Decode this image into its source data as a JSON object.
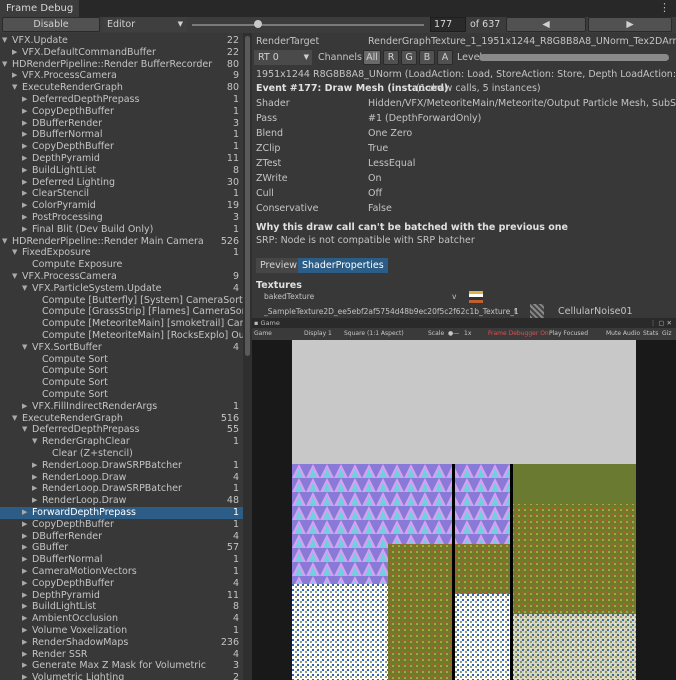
{
  "window": {
    "title": "Frame Debug",
    "menu_icon": "kebab-menu-icon"
  },
  "toolbar": {
    "disable_label": "Disable",
    "editor_label": "Editor",
    "event_index": "177",
    "event_total": "of 637",
    "slider_value": 0.28
  },
  "tree": [
    {
      "label": "VFX.Update",
      "count": "22",
      "depth": 0,
      "arrow": "down"
    },
    {
      "label": "VFX.DefaultCommandBuffer",
      "count": "22",
      "depth": 1,
      "arrow": "right"
    },
    {
      "label": "HDRenderPipeline::Render BufferRecorder",
      "count": "80",
      "depth": 0,
      "arrow": "down"
    },
    {
      "label": "VFX.ProcessCamera",
      "count": "9",
      "depth": 1,
      "arrow": "right"
    },
    {
      "label": "ExecuteRenderGraph",
      "count": "80",
      "depth": 1,
      "arrow": "down"
    },
    {
      "label": "DeferredDepthPrepass",
      "count": "1",
      "depth": 2,
      "arrow": "right"
    },
    {
      "label": "CopyDepthBuffer",
      "count": "1",
      "depth": 2,
      "arrow": "right"
    },
    {
      "label": "DBufferRender",
      "count": "3",
      "depth": 2,
      "arrow": "right"
    },
    {
      "label": "DBufferNormal",
      "count": "1",
      "depth": 2,
      "arrow": "right"
    },
    {
      "label": "CopyDepthBuffer",
      "count": "1",
      "depth": 2,
      "arrow": "right"
    },
    {
      "label": "DepthPyramid",
      "count": "11",
      "depth": 2,
      "arrow": "right"
    },
    {
      "label": "BuildLightList",
      "count": "8",
      "depth": 2,
      "arrow": "right"
    },
    {
      "label": "Deferred Lighting",
      "count": "30",
      "depth": 2,
      "arrow": "right"
    },
    {
      "label": "ClearStencil",
      "count": "1",
      "depth": 2,
      "arrow": "right"
    },
    {
      "label": "ColorPyramid",
      "count": "19",
      "depth": 2,
      "arrow": "right"
    },
    {
      "label": "PostProcessing",
      "count": "3",
      "depth": 2,
      "arrow": "right"
    },
    {
      "label": "Final Blit (Dev Build Only)",
      "count": "1",
      "depth": 2,
      "arrow": "right"
    },
    {
      "label": "HDRenderPipeline::Render Main Camera",
      "count": "526",
      "depth": 0,
      "arrow": "down"
    },
    {
      "label": "FixedExposure",
      "count": "1",
      "depth": 1,
      "arrow": "down"
    },
    {
      "label": "Compute Exposure",
      "count": "",
      "depth": 2,
      "arrow": ""
    },
    {
      "label": "VFX.ProcessCamera",
      "count": "9",
      "depth": 1,
      "arrow": "down"
    },
    {
      "label": "VFX.ParticleSystem.Update",
      "count": "4",
      "depth": 2,
      "arrow": "down"
    },
    {
      "label": "Compute [Butterfly] [System] CameraSort",
      "count": "",
      "depth": 3,
      "arrow": ""
    },
    {
      "label": "Compute [GrassStrip] [Flames] CameraSort",
      "count": "",
      "depth": 3,
      "arrow": ""
    },
    {
      "label": "Compute [MeteoriteMain] [smoketrail] CameraSo",
      "count": "",
      "depth": 3,
      "arrow": ""
    },
    {
      "label": "Compute [MeteoriteMain] [RocksExplo] OutputU",
      "count": "",
      "depth": 3,
      "arrow": ""
    },
    {
      "label": "VFX.SortBuffer",
      "count": "4",
      "depth": 2,
      "arrow": "down"
    },
    {
      "label": "Compute Sort",
      "count": "",
      "depth": 3,
      "arrow": ""
    },
    {
      "label": "Compute Sort",
      "count": "",
      "depth": 3,
      "arrow": ""
    },
    {
      "label": "Compute Sort",
      "count": "",
      "depth": 3,
      "arrow": ""
    },
    {
      "label": "Compute Sort",
      "count": "",
      "depth": 3,
      "arrow": ""
    },
    {
      "label": "VFX.FillIndirectRenderArgs",
      "count": "1",
      "depth": 2,
      "arrow": "right"
    },
    {
      "label": "ExecuteRenderGraph",
      "count": "516",
      "depth": 1,
      "arrow": "down"
    },
    {
      "label": "DeferredDepthPrepass",
      "count": "55",
      "depth": 2,
      "arrow": "down"
    },
    {
      "label": "RenderGraphClear",
      "count": "1",
      "depth": 3,
      "arrow": "down"
    },
    {
      "label": "Clear (Z+stencil)",
      "count": "",
      "depth": 4,
      "arrow": ""
    },
    {
      "label": "RenderLoop.DrawSRPBatcher",
      "count": "1",
      "depth": 3,
      "arrow": "right"
    },
    {
      "label": "RenderLoop.Draw",
      "count": "4",
      "depth": 3,
      "arrow": "right"
    },
    {
      "label": "RenderLoop.DrawSRPBatcher",
      "count": "1",
      "depth": 3,
      "arrow": "right"
    },
    {
      "label": "RenderLoop.Draw",
      "count": "48",
      "depth": 3,
      "arrow": "right"
    },
    {
      "label": "ForwardDepthPrepass",
      "count": "1",
      "depth": 2,
      "arrow": "right",
      "selected": true
    },
    {
      "label": "CopyDepthBuffer",
      "count": "1",
      "depth": 2,
      "arrow": "right"
    },
    {
      "label": "DBufferRender",
      "count": "4",
      "depth": 2,
      "arrow": "right"
    },
    {
      "label": "GBuffer",
      "count": "57",
      "depth": 2,
      "arrow": "right"
    },
    {
      "label": "DBufferNormal",
      "count": "1",
      "depth": 2,
      "arrow": "right"
    },
    {
      "label": "CameraMotionVectors",
      "count": "1",
      "depth": 2,
      "arrow": "right"
    },
    {
      "label": "CopyDepthBuffer",
      "count": "4",
      "depth": 2,
      "arrow": "right"
    },
    {
      "label": "DepthPyramid",
      "count": "11",
      "depth": 2,
      "arrow": "right"
    },
    {
      "label": "BuildLightList",
      "count": "8",
      "depth": 2,
      "arrow": "right"
    },
    {
      "label": "AmbientOcclusion",
      "count": "4",
      "depth": 2,
      "arrow": "right"
    },
    {
      "label": "Volume Voxelization",
      "count": "1",
      "depth": 2,
      "arrow": "right"
    },
    {
      "label": "RenderShadowMaps",
      "count": "236",
      "depth": 2,
      "arrow": "right"
    },
    {
      "label": "Render SSR",
      "count": "4",
      "depth": 2,
      "arrow": "right"
    },
    {
      "label": "Generate Max Z Mask for Volumetric",
      "count": "3",
      "depth": 2,
      "arrow": "right"
    },
    {
      "label": "Volumetric Lighting",
      "count": "2",
      "depth": 2,
      "arrow": "right"
    }
  ],
  "details": {
    "render_target_label": "RenderTarget",
    "render_target_value": "RenderGraphTexture_1_1951x1244_R8G8B8A8_UNorm_Tex2DArray",
    "rt_select": "RT 0",
    "channels_label": "Channels",
    "channel_all": "All",
    "channel_r": "R",
    "channel_g": "G",
    "channel_b": "B",
    "channel_a": "A",
    "levels_label": "Levels",
    "format_line": "1951x1244 R8G8B8A8_UNorm (LoadAction: Load, StoreAction: Store, Depth LoadAction: Load, Dept",
    "event_title": "Event #177: Draw Mesh (instanced)",
    "event_sub": "(1 draw calls, 5 instances)",
    "props": [
      {
        "name": "Shader",
        "value": "Hidden/VFX/MeteoriteMain/Meteorite/Output Particle Mesh, SubShader #"
      },
      {
        "name": "Pass",
        "value": "#1 (DepthForwardOnly)"
      },
      {
        "name": "Blend",
        "value": "One Zero"
      },
      {
        "name": "ZClip",
        "value": "True"
      },
      {
        "name": "ZTest",
        "value": "LessEqual"
      },
      {
        "name": "ZWrite",
        "value": "On"
      },
      {
        "name": "Cull",
        "value": "Off"
      },
      {
        "name": "Conservative",
        "value": "False"
      }
    ],
    "batch_title": "Why this draw call can't be batched with the previous one",
    "batch_reason": "SRP: Node is not compatible with SRP batcher",
    "tab_preview": "Preview",
    "tab_shader_props": "ShaderProperties",
    "textures_label": "Textures",
    "tex1_name": "bakedTexture",
    "tex1_v": "v",
    "tex2_name": "_SampleTexture2D_ee5ebf2af5754d48b9ec20f5c2f62c1b_Texture_1",
    "tex2_f": "f",
    "tex2_value": "CellularNoise01"
  },
  "game": {
    "tab_label": "Game",
    "display_mode": "Game",
    "display": "Display 1",
    "aspect": "Square (1:1 Aspect)",
    "scale_label": "Scale",
    "scale_value": "1x",
    "frame_debugger": "Frame Debugger On",
    "play_focused": "Play Focused",
    "mute_audio": "Mute Audio",
    "stats": "Stats",
    "gizmos": "Giz"
  }
}
